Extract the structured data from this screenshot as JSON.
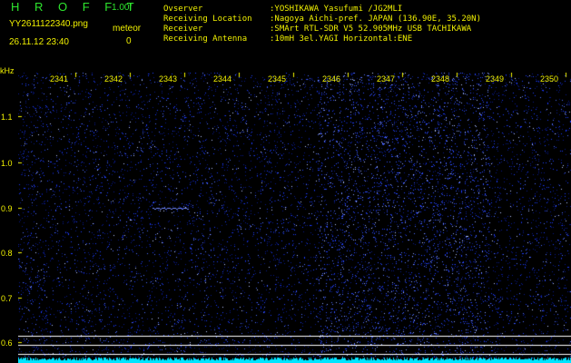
{
  "header": {
    "brand": "H R O F F T",
    "version": "1.00f",
    "filename": "YY2611122340.png",
    "datetime": "26.11.12 23:40",
    "meteor_label": "meteor",
    "meteor_count": "0"
  },
  "station_info": [
    {
      "key": "Ovserver",
      "value": ":YOSHIKAWA Yasufumi /JG2MLI"
    },
    {
      "key": "Receiving Location",
      "value": ":Nagoya Aichi-pref. JAPAN (136.90E, 35.20N)"
    },
    {
      "key": "Receiver",
      "value": ":SMArt RTL-SDR V5 52.905MHz USB TACHIKAWA"
    },
    {
      "key": "Receiving Antenna",
      "value": ":10mH 3el.YAGI Horizontal:ENE"
    }
  ],
  "axis": {
    "y_unit": "kHz",
    "y_ticks": [
      "1.1",
      "1.0",
      "0.9",
      "0.8",
      "0.7",
      "0.6"
    ],
    "x_ticks": [
      "2341",
      "2342",
      "2343",
      "2344",
      "2345",
      "2346",
      "2347",
      "2348",
      "2349",
      "2350"
    ]
  },
  "colors": {
    "text": "#f0f000",
    "brand": "#2ee62e",
    "background": "#000000",
    "noise": "#1e3cff",
    "trace": "#00e5ff",
    "guide_line": "#ffffff"
  }
}
